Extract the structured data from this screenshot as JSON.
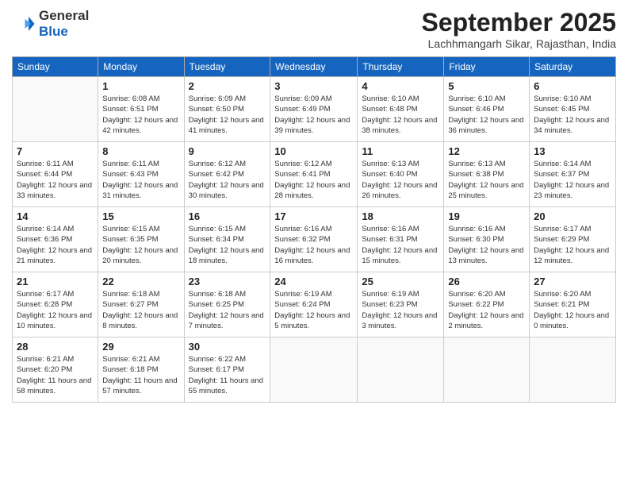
{
  "logo": {
    "line1": "General",
    "line2": "Blue"
  },
  "title": "September 2025",
  "subtitle": "Lachhmangarh Sikar, Rajasthan, India",
  "days_of_week": [
    "Sunday",
    "Monday",
    "Tuesday",
    "Wednesday",
    "Thursday",
    "Friday",
    "Saturday"
  ],
  "weeks": [
    [
      null,
      {
        "day": 1,
        "sunrise": "6:08 AM",
        "sunset": "6:51 PM",
        "daylight": "12 hours and 42 minutes."
      },
      {
        "day": 2,
        "sunrise": "6:09 AM",
        "sunset": "6:50 PM",
        "daylight": "12 hours and 41 minutes."
      },
      {
        "day": 3,
        "sunrise": "6:09 AM",
        "sunset": "6:49 PM",
        "daylight": "12 hours and 39 minutes."
      },
      {
        "day": 4,
        "sunrise": "6:10 AM",
        "sunset": "6:48 PM",
        "daylight": "12 hours and 38 minutes."
      },
      {
        "day": 5,
        "sunrise": "6:10 AM",
        "sunset": "6:46 PM",
        "daylight": "12 hours and 36 minutes."
      },
      {
        "day": 6,
        "sunrise": "6:10 AM",
        "sunset": "6:45 PM",
        "daylight": "12 hours and 34 minutes."
      }
    ],
    [
      {
        "day": 7,
        "sunrise": "6:11 AM",
        "sunset": "6:44 PM",
        "daylight": "12 hours and 33 minutes."
      },
      {
        "day": 8,
        "sunrise": "6:11 AM",
        "sunset": "6:43 PM",
        "daylight": "12 hours and 31 minutes."
      },
      {
        "day": 9,
        "sunrise": "6:12 AM",
        "sunset": "6:42 PM",
        "daylight": "12 hours and 30 minutes."
      },
      {
        "day": 10,
        "sunrise": "6:12 AM",
        "sunset": "6:41 PM",
        "daylight": "12 hours and 28 minutes."
      },
      {
        "day": 11,
        "sunrise": "6:13 AM",
        "sunset": "6:40 PM",
        "daylight": "12 hours and 26 minutes."
      },
      {
        "day": 12,
        "sunrise": "6:13 AM",
        "sunset": "6:38 PM",
        "daylight": "12 hours and 25 minutes."
      },
      {
        "day": 13,
        "sunrise": "6:14 AM",
        "sunset": "6:37 PM",
        "daylight": "12 hours and 23 minutes."
      }
    ],
    [
      {
        "day": 14,
        "sunrise": "6:14 AM",
        "sunset": "6:36 PM",
        "daylight": "12 hours and 21 minutes."
      },
      {
        "day": 15,
        "sunrise": "6:15 AM",
        "sunset": "6:35 PM",
        "daylight": "12 hours and 20 minutes."
      },
      {
        "day": 16,
        "sunrise": "6:15 AM",
        "sunset": "6:34 PM",
        "daylight": "12 hours and 18 minutes."
      },
      {
        "day": 17,
        "sunrise": "6:16 AM",
        "sunset": "6:32 PM",
        "daylight": "12 hours and 16 minutes."
      },
      {
        "day": 18,
        "sunrise": "6:16 AM",
        "sunset": "6:31 PM",
        "daylight": "12 hours and 15 minutes."
      },
      {
        "day": 19,
        "sunrise": "6:16 AM",
        "sunset": "6:30 PM",
        "daylight": "12 hours and 13 minutes."
      },
      {
        "day": 20,
        "sunrise": "6:17 AM",
        "sunset": "6:29 PM",
        "daylight": "12 hours and 12 minutes."
      }
    ],
    [
      {
        "day": 21,
        "sunrise": "6:17 AM",
        "sunset": "6:28 PM",
        "daylight": "12 hours and 10 minutes."
      },
      {
        "day": 22,
        "sunrise": "6:18 AM",
        "sunset": "6:27 PM",
        "daylight": "12 hours and 8 minutes."
      },
      {
        "day": 23,
        "sunrise": "6:18 AM",
        "sunset": "6:25 PM",
        "daylight": "12 hours and 7 minutes."
      },
      {
        "day": 24,
        "sunrise": "6:19 AM",
        "sunset": "6:24 PM",
        "daylight": "12 hours and 5 minutes."
      },
      {
        "day": 25,
        "sunrise": "6:19 AM",
        "sunset": "6:23 PM",
        "daylight": "12 hours and 3 minutes."
      },
      {
        "day": 26,
        "sunrise": "6:20 AM",
        "sunset": "6:22 PM",
        "daylight": "12 hours and 2 minutes."
      },
      {
        "day": 27,
        "sunrise": "6:20 AM",
        "sunset": "6:21 PM",
        "daylight": "12 hours and 0 minutes."
      }
    ],
    [
      {
        "day": 28,
        "sunrise": "6:21 AM",
        "sunset": "6:20 PM",
        "daylight": "11 hours and 58 minutes."
      },
      {
        "day": 29,
        "sunrise": "6:21 AM",
        "sunset": "6:18 PM",
        "daylight": "11 hours and 57 minutes."
      },
      {
        "day": 30,
        "sunrise": "6:22 AM",
        "sunset": "6:17 PM",
        "daylight": "11 hours and 55 minutes."
      },
      null,
      null,
      null,
      null
    ]
  ]
}
